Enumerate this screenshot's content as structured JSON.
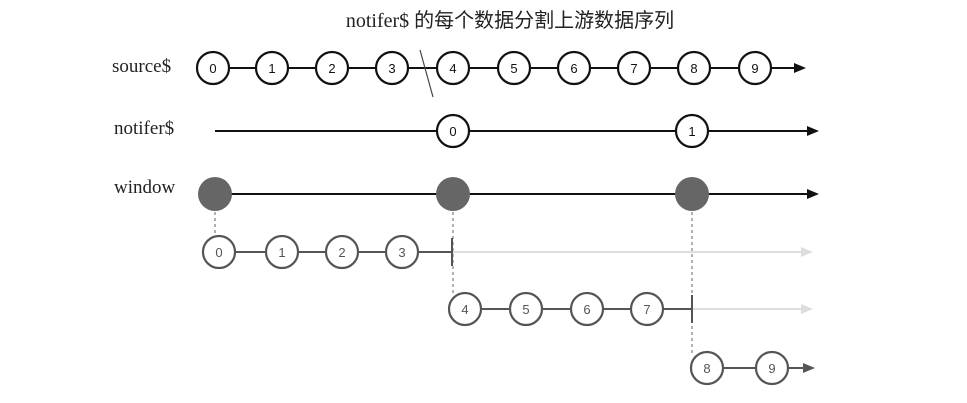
{
  "title": "notifer$ 的每个数据分割上游数据序列",
  "rows": {
    "source": {
      "label": "source$",
      "values": [
        "0",
        "1",
        "2",
        "3",
        "4",
        "5",
        "6",
        "7",
        "8",
        "9"
      ]
    },
    "notifier": {
      "label": "notifer$",
      "values": [
        "0",
        "1"
      ]
    },
    "window": {
      "label": "window"
    }
  },
  "windows": [
    {
      "values": [
        "0",
        "1",
        "2",
        "3"
      ],
      "completed": true
    },
    {
      "values": [
        "4",
        "5",
        "6",
        "7"
      ],
      "completed": true
    },
    {
      "values": [
        "8",
        "9"
      ],
      "completed": false
    }
  ],
  "colors": {
    "main": "#111111",
    "window_marble": "#666666",
    "inner": "#555555",
    "faded": "#dddddd"
  }
}
